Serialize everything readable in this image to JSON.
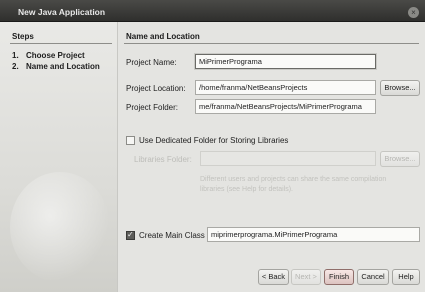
{
  "window": {
    "title": "New Java Application",
    "close_glyph": "×"
  },
  "steps": {
    "heading": "Steps",
    "items": [
      {
        "num": "1.",
        "label": "Choose Project"
      },
      {
        "num": "2.",
        "label": "Name and Location"
      }
    ]
  },
  "panel": {
    "heading": "Name and Location",
    "project_name": {
      "label": "Project Name:",
      "value": "MiPrimerPrograma"
    },
    "project_location": {
      "label": "Project Location:",
      "value": "/home/franma/NetBeansProjects",
      "browse": "Browse..."
    },
    "project_folder": {
      "label": "Project Folder:",
      "value": "me/franma/NetBeansProjects/MiPrimerPrograma"
    },
    "dedicated_folder": {
      "label": "Use Dedicated Folder for Storing Libraries",
      "checked": false
    },
    "libraries_folder": {
      "label": "Libraries Folder:",
      "value": "",
      "browse": "Browse..."
    },
    "libraries_note": "Different users and projects can share the same compilation libraries (see Help for details).",
    "main_class": {
      "label": "Create Main Class",
      "checked": true,
      "value": "miprimerprograma.MiPrimerPrograma"
    }
  },
  "buttons": {
    "back": "< Back",
    "next": "Next >",
    "finish": "Finish",
    "cancel": "Cancel",
    "help": "Help"
  }
}
